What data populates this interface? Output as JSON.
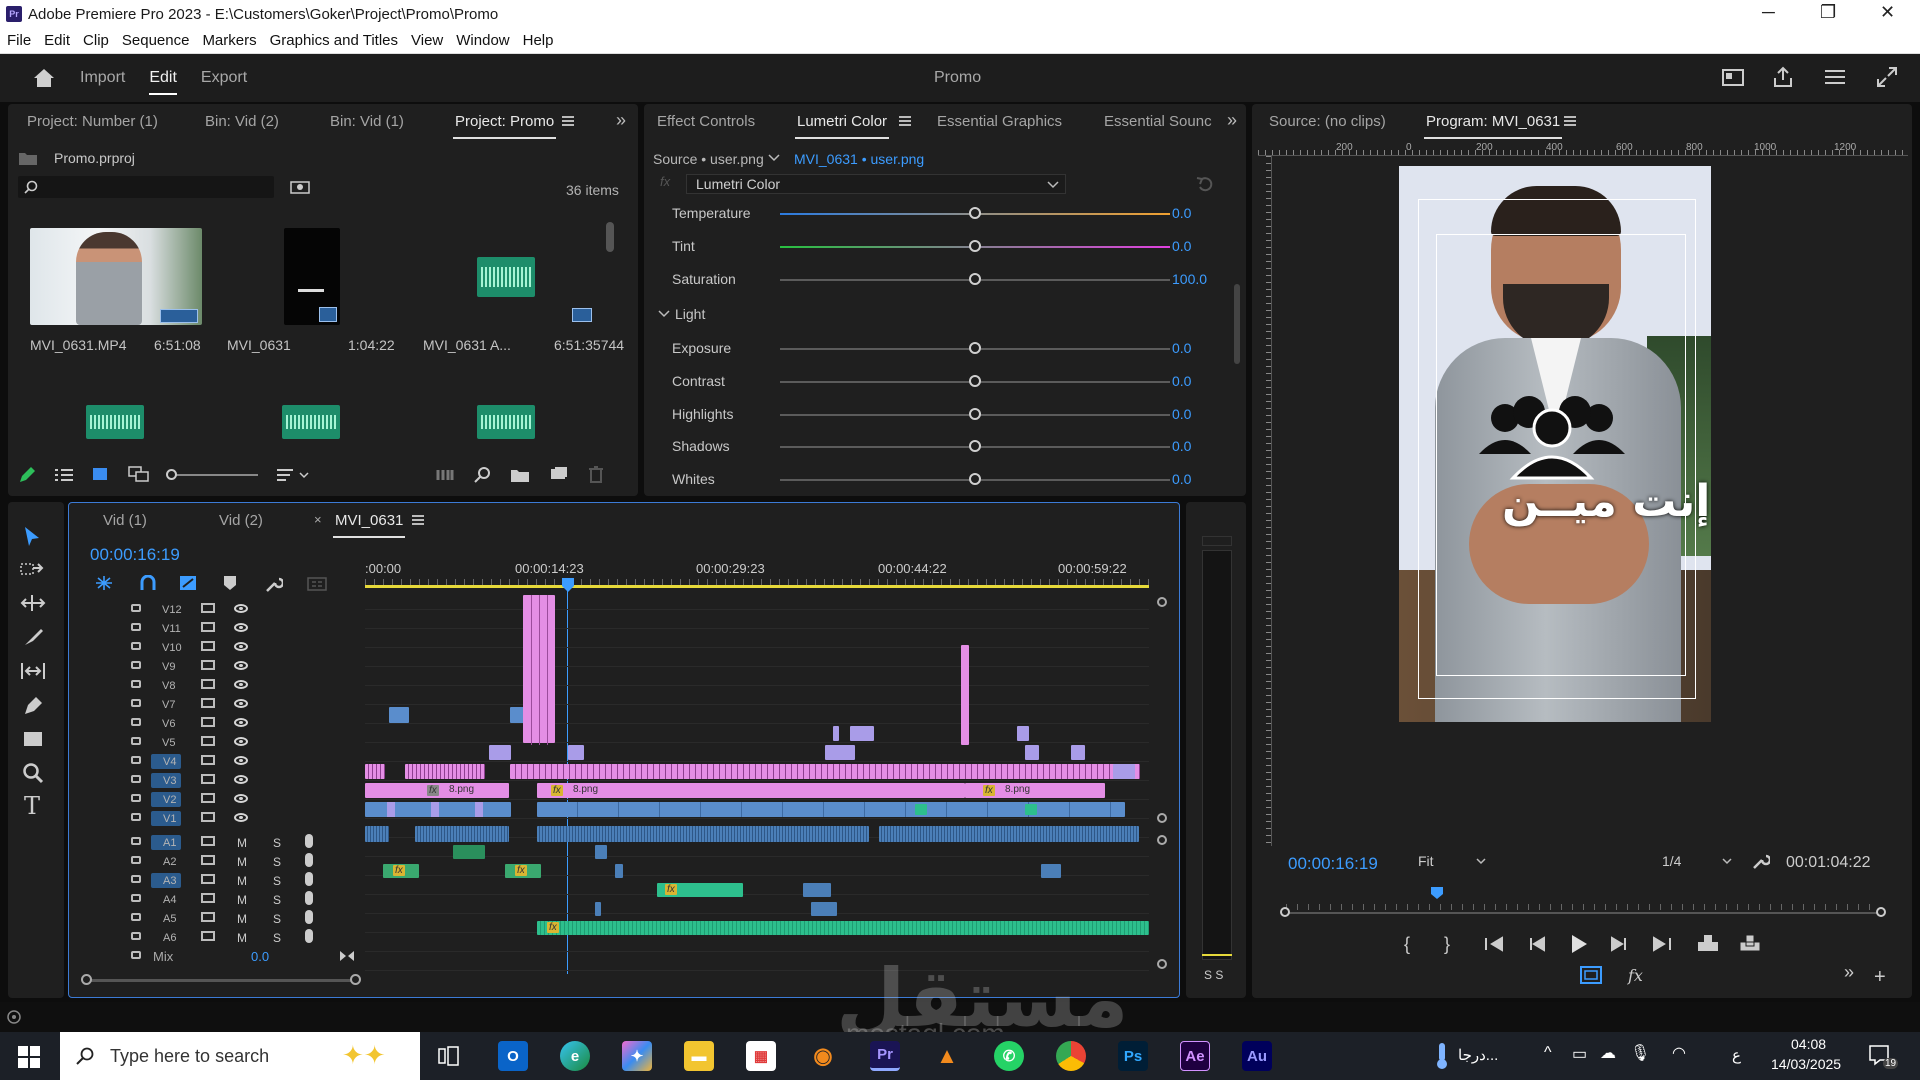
{
  "window": {
    "title": "Adobe Premiere Pro 2023 - E:\\Customers\\Goker\\Project\\Promo\\Promo",
    "logo": "Pr"
  },
  "menu": [
    "File",
    "Edit",
    "Clip",
    "Sequence",
    "Markers",
    "Graphics and Titles",
    "View",
    "Window",
    "Help"
  ],
  "workspace": {
    "tabs": [
      "Import",
      "Edit",
      "Export"
    ],
    "active": "Edit",
    "project_name": "Promo"
  },
  "project_panel": {
    "tabs": [
      "Project: Number (1)",
      "Bin: Vid (2)",
      "Bin: Vid (1)",
      "Project: Promo"
    ],
    "active_tab": "Project: Promo",
    "file": "Promo.prproj",
    "items_count": "36 items",
    "items": [
      {
        "name": "MVI_0631.MP4",
        "duration": "6:51:08"
      },
      {
        "name": "MVI_0631",
        "duration": "1:04:22"
      },
      {
        "name": "MVI_0631 A...",
        "duration": "6:51:35744"
      }
    ]
  },
  "effects_panel": {
    "tabs": [
      "Effect Controls",
      "Lumetri Color",
      "Essential Graphics",
      "Essential Sounc"
    ],
    "active_tab": "Lumetri Color",
    "source": "Source • user.png",
    "clip": "MVI_0631 • user.png",
    "effect": "Lumetri Color",
    "section_light": "Light",
    "rows": [
      {
        "label": "Temperature",
        "value": "0.0"
      },
      {
        "label": "Tint",
        "value": "0.0"
      },
      {
        "label": "Saturation",
        "value": "100.0"
      },
      {
        "label": "Exposure",
        "value": "0.0"
      },
      {
        "label": "Contrast",
        "value": "0.0"
      },
      {
        "label": "Highlights",
        "value": "0.0"
      },
      {
        "label": "Shadows",
        "value": "0.0"
      },
      {
        "label": "Whites",
        "value": "0.0"
      }
    ]
  },
  "monitor": {
    "source_tab": "Source: (no clips)",
    "program_tab": "Program: MVI_0631",
    "ruler": [
      "200",
      "0",
      "200",
      "400",
      "600",
      "800",
      "1000",
      "1200"
    ],
    "timecode": "00:00:16:19",
    "fit": "Fit",
    "resolution": "1/4",
    "duration": "00:01:04:22",
    "overlay_text": "إنت ميــن"
  },
  "timeline": {
    "tabs": [
      "Vid (1)",
      "Vid (2)",
      "MVI_0631"
    ],
    "active_tab": "MVI_0631",
    "timecode": "00:00:16:19",
    "ruler": [
      ":00:00",
      "00:00:14:23",
      "00:00:29:23",
      "00:00:44:22",
      "00:00:59:22"
    ],
    "video_tracks": [
      "V12",
      "V11",
      "V10",
      "V9",
      "V8",
      "V7",
      "V6",
      "V5",
      "V4",
      "V3",
      "V2",
      "V1"
    ],
    "audio_tracks": [
      "A1",
      "A2",
      "A3",
      "A4",
      "A5",
      "A6"
    ],
    "mix_label": "Mix",
    "mix_value": "0.0",
    "clip_label": "8.png",
    "m": "M",
    "s": "S",
    "meter": "S S"
  },
  "taskbar": {
    "search_placeholder": "Type here to search",
    "weather": "درجا...",
    "lang": "ع",
    "time": "04:08",
    "date": "14/03/2025",
    "notifications": "19",
    "apps": [
      "Pr",
      "Ps",
      "Ae",
      "Au"
    ]
  },
  "watermark": {
    "arabic": "مستقل",
    "latin": "mostaql.com"
  },
  "colors": {
    "accent_blue": "#3c9cff",
    "clip_pink": "#e48ee5",
    "clip_violet": "#a99ce8",
    "clip_blue": "#5a8dcc",
    "clip_green": "#2dbf8d",
    "playhead": "#3c9cff"
  }
}
